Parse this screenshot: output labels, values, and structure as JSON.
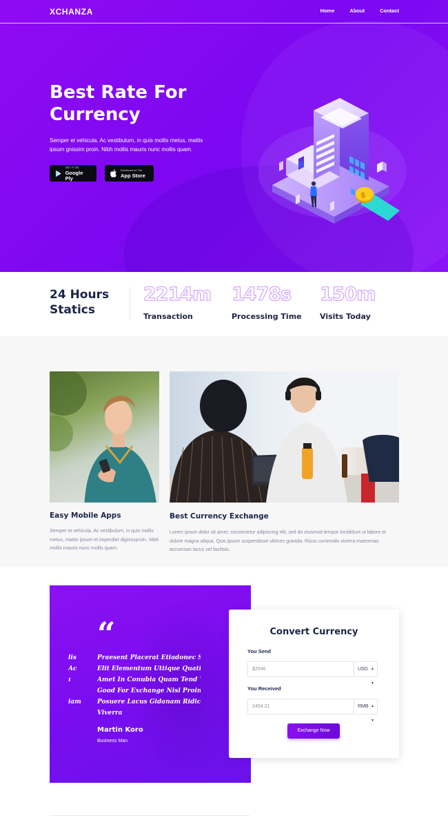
{
  "brand": {
    "logo": "XCHANZA"
  },
  "nav": {
    "items": [
      "Home",
      "About",
      "Contact"
    ]
  },
  "hero": {
    "title": "Best Rate For Currency",
    "description": "Semper et vehicula. Ac vestibulum, in quis mollis metus, mattis ipsum gnissim proin. Nibh mollis mauris nunc mollis quam.",
    "google_btn": {
      "small": "GET IT ON",
      "big": "Google Ply"
    },
    "apple_btn": {
      "small": "Download on The",
      "big": "App Store"
    }
  },
  "stats": {
    "title": "24 Hours Statics",
    "items": [
      {
        "value": "2214m",
        "label": "Transaction"
      },
      {
        "value": "1478s",
        "label": "Processing Time"
      },
      {
        "value": "150m",
        "label": "Visits Today"
      }
    ]
  },
  "features": [
    {
      "title": "Easy Mobile Apps",
      "text": "Semper et vehicula. Ac vestibulum, in quis mollis metus, mattis ipsum et imperdiet dignissproin. Nibh mollis mauris nunc mollis quam."
    },
    {
      "title": "Best Currency Exchange",
      "text": "Lorem ipsum dolor sit amet, consectetur adipiscing elit, sed do eiusmod tempor incididunt ut labore et dolore magna aliqua. Quis ipsum suspendisse ultrices gravida. Risus commodo viverra maecenas accumsan lacus vel facilisis."
    }
  ],
  "testimonial": {
    "side_fragments": [
      "lis",
      "Ac",
      "ı",
      "",
      "iam"
    ],
    "lines": [
      "Praesent Placerat Etiadonec Sollicitudin",
      "Elit Elementum Uttique Quatique Porta",
      "Amet In Conubia Quam Tend Tincidunt",
      "Good For Exchange Nisl Proin Odio",
      "Posuere Lacus Gidanam Ridiculus",
      "Viverra"
    ],
    "name": "Martin Koro",
    "role": "Business Man"
  },
  "converter": {
    "title": "Convert Currency",
    "send_label": "You Send",
    "send_value": "$2546",
    "send_currency": "USD",
    "receive_label": "You Received",
    "receive_value": "2454.21",
    "receive_currency": "RMB",
    "button": "Exchange Now"
  },
  "colors": {
    "primary": "#7b08f1",
    "dark_text": "#1b2548",
    "muted_text": "#858a99",
    "stat_outline": "#d4a4fa"
  },
  "icons": {
    "google_play": "play-triangle-icon",
    "apple": "apple-icon",
    "quote": "quote-icon",
    "caret": "caret-updown-icon"
  }
}
